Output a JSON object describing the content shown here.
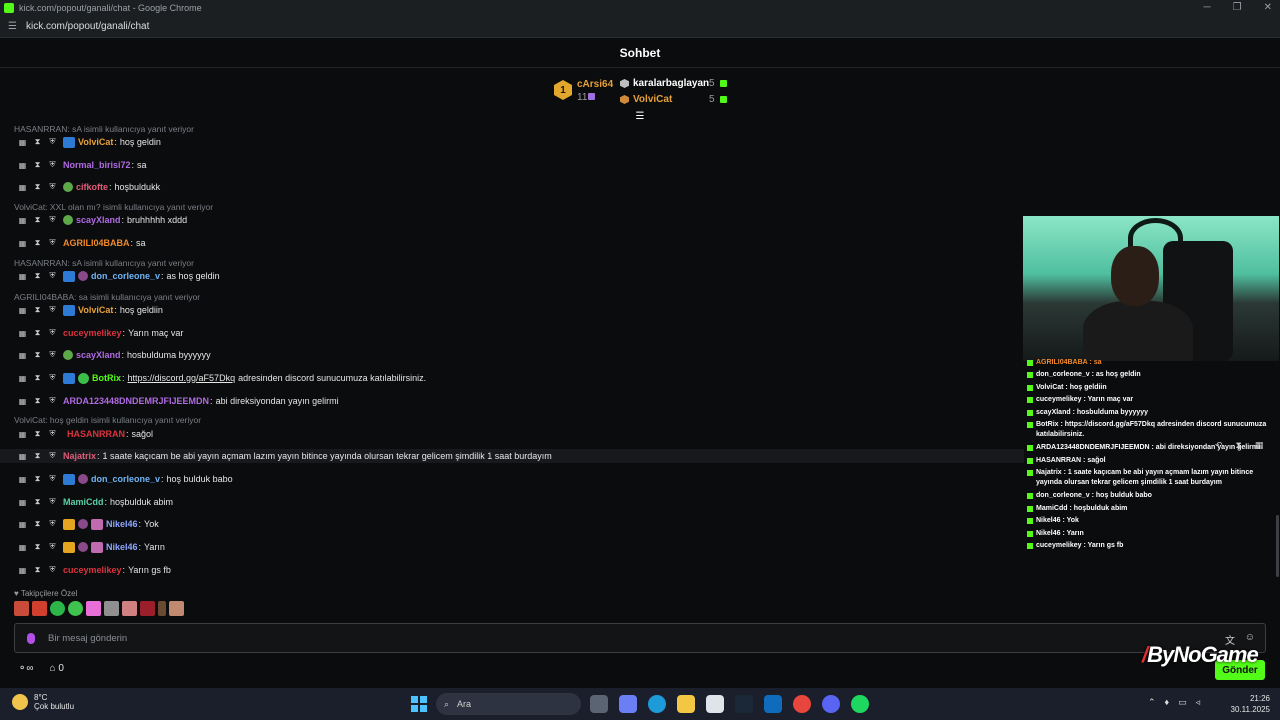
{
  "window": {
    "title": "kick.com/popout/ganali/chat - Google Chrome",
    "url": "kick.com/popout/ganali/chat"
  },
  "header": {
    "title": "Sohbet"
  },
  "leaderboard": [
    {
      "name": "cArsi64",
      "rank": "1",
      "count": "11"
    },
    {
      "name": "karalarbaglayan",
      "count": "5"
    },
    {
      "name": "VolviCat",
      "count": "5"
    }
  ],
  "chat": {
    "replies": [
      "HASANRRAN: sA isimli kullanıcıya yanıt veriyor",
      "VolviCat: XXL olan mı? isimli kullanıcıya yanıt veriyor",
      "HASANRRAN: sA isimli kullanıcıya yanıt veriyor",
      "AGRILI04BABA: sa isimli kullanıcıya yanıt veriyor",
      "VolviCat: hoş geldin isimli kullanıcıya yanıt veriyor"
    ],
    "messages": [
      {
        "user": "VolviCat",
        "color": "#e8a13a",
        "text": "hoş geldin"
      },
      {
        "user": "Normal_birisi72",
        "color": "#b06be3",
        "text": "sa"
      },
      {
        "user": "cifkofte",
        "color": "#e05c7a",
        "text": "hoşbuldukk"
      },
      {
        "user": "scayXland",
        "color": "#b06be3",
        "text": "bruhhhhh xddd"
      },
      {
        "user": "AGRILI04BABA",
        "color": "#f08a2c",
        "text": "sa"
      },
      {
        "user": "don_corleone_v",
        "color": "#6fb4f5",
        "text": "as hoş geldin"
      },
      {
        "user": "VolviCat",
        "color": "#e8a13a",
        "text": "hoş geldiin"
      },
      {
        "user": "cuceymelikey",
        "color": "#d9343f",
        "text": "Yarın maç var"
      },
      {
        "user": "scayXland",
        "color": "#b06be3",
        "text": "hosbulduma byyyyyy"
      },
      {
        "user": "BotRix",
        "color": "#53fc18",
        "link": "https://discord.gg/aF57Dkq",
        "text": "adresinden discord sunucumuza katılabilirsiniz."
      },
      {
        "user": "ARDA123448DNDEMRJFIJEEMDN",
        "color": "#b06be3",
        "text": "abi direksiyondan yayın gelirmi"
      },
      {
        "user": "HASANRRAN",
        "color": "#d9343f",
        "text": "sağol"
      },
      {
        "user": "Najatrix",
        "color": "#e05c7a",
        "text": "1 saate kaçıcam be abi yayın açmam lazım yayın bitince yayında olursan tekrar gelicem şimdilik 1 saat burdayım"
      },
      {
        "user": "don_corleone_v",
        "color": "#6fb4f5",
        "text": "hoş bulduk babo"
      },
      {
        "user": "MamiCdd",
        "color": "#5ed0a8",
        "text": "hoşbulduk abim"
      },
      {
        "user": "Nikel46",
        "color": "#8fa8ff",
        "text": "Yok"
      },
      {
        "user": "Nikel46",
        "color": "#8fa8ff",
        "text": "Yarın"
      },
      {
        "user": "cuceymelikey",
        "color": "#d9343f",
        "text": "Yarın gs fb"
      }
    ]
  },
  "followers_label": "Takipçilere Özel",
  "input": {
    "placeholder": "Bir mesaj gönderin",
    "send_label": "Gönder"
  },
  "footer": {
    "points": "0"
  },
  "overlay": {
    "lines": [
      "AGRILI04BABA : sa",
      "don_corleone_v : as hoş geldin",
      "VolviCat : hoş geldiin",
      "cuceymelikey : Yarın maç var",
      "scayXland : hosbulduma byyyyyy",
      "BotRix : https://discord.gg/aF57Dkq adresinden discord sunucumuza katılabilirsiniz.",
      "ARDA123448DNDEMRJFIJEEMDN : abi direksiyondan yayın gelirmi",
      "HASANRRAN : sağol",
      "Najatrix : 1 saate kaçıcam be abi yayın açmam lazım yayın bitince yayında olursan tekrar gelicem şimdilik 1 saat burdayım",
      "don_corleone_v : hoş bulduk babo",
      "MamiCdd : hoşbulduk abim",
      "Nikel46 : Yok",
      "Nikel46 : Yarın",
      "cuceymelikey : Yarın gs fb"
    ]
  },
  "watermark": "ByNoGame",
  "taskbar": {
    "temp": "8°C",
    "weather": "Çok bulutlu",
    "search": "Ara",
    "time": "21:26",
    "date": "30.11.2025"
  },
  "colors": {
    "accent": "#53fc18",
    "background": "#0b0c0d"
  }
}
